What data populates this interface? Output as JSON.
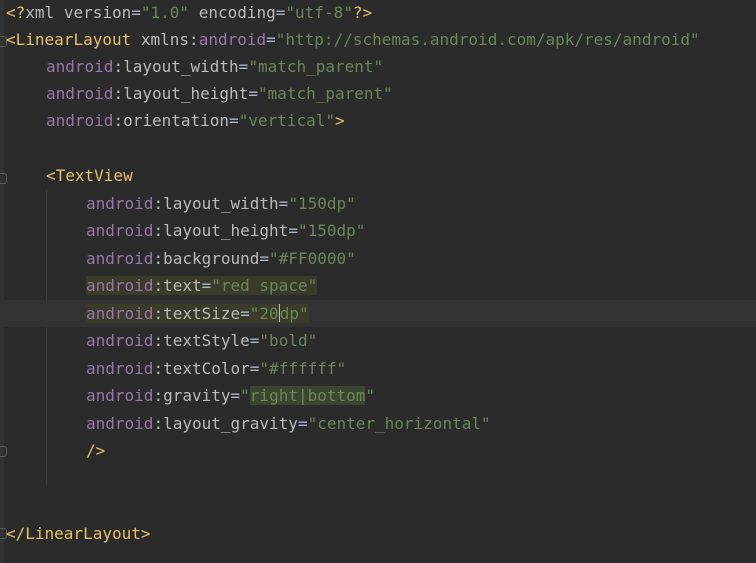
{
  "editor": {
    "decl": {
      "open": "<?",
      "name": "xml",
      "version_attr": "version",
      "version_val": "\"1.0\"",
      "encoding_attr": "encoding",
      "encoding_val": "\"utf-8\"",
      "close": "?>"
    },
    "root_open": {
      "bracket": "<",
      "tag": "LinearLayout",
      "xmlns_attr": "xmlns",
      "colon": ":",
      "xmlns_ns": "android",
      "eq": "=",
      "xmlns_val": "\"http://schemas.android.com/apk/res/android\""
    },
    "root_attrs": [
      {
        "ns": "android",
        "name": "layout_width",
        "value": "\"match_parent\"",
        "suffix": ""
      },
      {
        "ns": "android",
        "name": "layout_height",
        "value": "\"match_parent\"",
        "suffix": ""
      },
      {
        "ns": "android",
        "name": "orientation",
        "value": "\"vertical\"",
        "suffix": ">"
      }
    ],
    "textview_open": "<TextView",
    "textview_attrs": [
      {
        "ns": "android",
        "name": "layout_width",
        "value": "\"150dp\""
      },
      {
        "ns": "android",
        "name": "layout_height",
        "value": "\"150dp\""
      },
      {
        "ns": "android",
        "name": "background",
        "value": "\"#FF0000\""
      },
      {
        "ns": "android",
        "name": "text",
        "value": "\"red space\""
      },
      {
        "ns": "android",
        "name": "textSize",
        "value_before_caret": "\"20",
        "value_after_caret": "dp\""
      },
      {
        "ns": "android",
        "name": "textStyle",
        "value": "\"bold\""
      },
      {
        "ns": "android",
        "name": "textColor",
        "value": "\"#ffffff\""
      },
      {
        "ns": "android",
        "name": "gravity",
        "value_open": "\"",
        "value_hl": "right|bottom",
        "value_close": "\""
      },
      {
        "ns": "android",
        "name": "layout_gravity",
        "value": "\"center_horizontal\""
      }
    ],
    "textview_close": "/>",
    "root_close": "</LinearLayout>"
  }
}
